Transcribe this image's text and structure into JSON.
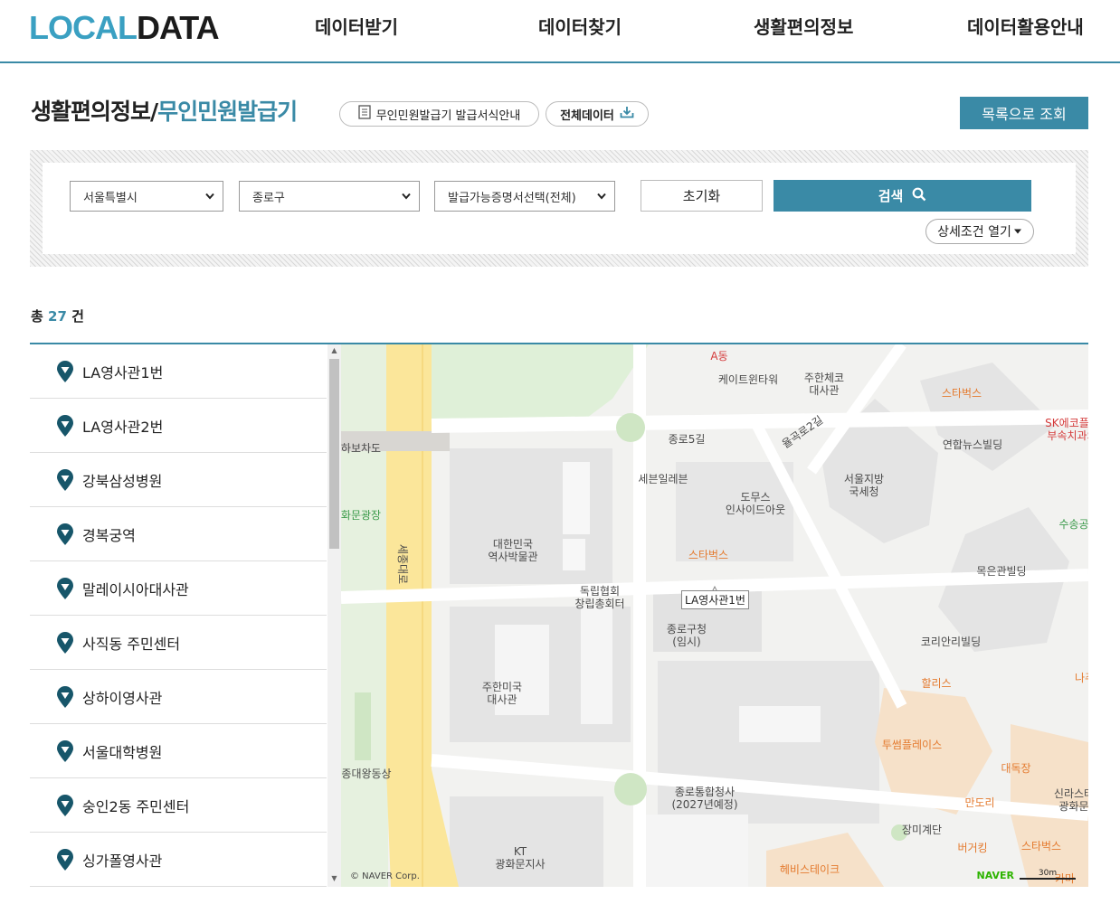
{
  "header": {
    "logo_local": "LOCAL",
    "logo_data": "DATA",
    "nav": [
      "데이터받기",
      "데이터찾기",
      "생활편의정보",
      "데이터활용안내"
    ]
  },
  "title": {
    "main": "생활편의정보/",
    "sub": "무인민원발급기",
    "guide_button": "무인민원발급기 발급서식안내",
    "full_data_button": "전체데이터",
    "list_button": "목록으로 조회"
  },
  "search": {
    "region": "서울특별시",
    "district": "종로구",
    "certificate": "발급가능증명서선택(전체)",
    "reset_label": "초기화",
    "search_label": "검색",
    "detail_label": "상세조건 열기"
  },
  "count": {
    "prefix": "총",
    "value": "27",
    "suffix": "건"
  },
  "results": [
    "LA영사관1번",
    "LA영사관2번",
    "강북삼성병원",
    "경복궁역",
    "말레이시아대사관",
    "사직동 주민센터",
    "상하이영사관",
    "서울대학병원",
    "숭인2동 주민센터",
    "싱가폴영사관"
  ],
  "map": {
    "marker_label": "LA영사관1번",
    "copyright": "© NAVER Corp.",
    "brand": "NAVER",
    "scale": "30m",
    "pois": [
      {
        "name": "A동",
        "style": "red"
      },
      {
        "name": "케이트윈타워",
        "style": "gray"
      },
      {
        "name": "주한체코\n대사관",
        "style": "gray"
      },
      {
        "name": "스타벅스",
        "style": "orange"
      },
      {
        "name": "SK에코플랜\n부속치과의",
        "style": "red"
      },
      {
        "name": "연합뉴스빌딩",
        "style": "gray"
      },
      {
        "name": "종로5길",
        "style": "gray"
      },
      {
        "name": "율곡로2길",
        "style": "gray"
      },
      {
        "name": "하보차도",
        "style": "gray"
      },
      {
        "name": "세븐일레븐",
        "style": "gray"
      },
      {
        "name": "도무스\n인사이드아웃",
        "style": "gray"
      },
      {
        "name": "서울지방\n국세청",
        "style": "gray"
      },
      {
        "name": "수송공",
        "style": "green"
      },
      {
        "name": "화문광장",
        "style": "green"
      },
      {
        "name": "대한민국\n역사박물관",
        "style": "gray"
      },
      {
        "name": "스타벅스",
        "style": "orange"
      },
      {
        "name": "목은관빌딩",
        "style": "gray"
      },
      {
        "name": "세종대로",
        "style": "gray"
      },
      {
        "name": "독립협회\n창립총회터",
        "style": "gray"
      },
      {
        "name": "종로구청\n(임시)",
        "style": "gray"
      },
      {
        "name": "코리안리빌딩",
        "style": "gray"
      },
      {
        "name": "할리스",
        "style": "orange"
      },
      {
        "name": "나주",
        "style": "orange"
      },
      {
        "name": "주한미국\n대사관",
        "style": "gray"
      },
      {
        "name": "투썸플레이스",
        "style": "orange"
      },
      {
        "name": "대독장",
        "style": "orange"
      },
      {
        "name": "종대왕동상",
        "style": "gray"
      },
      {
        "name": "종로통합청사\n(2027년예정)",
        "style": "gray"
      },
      {
        "name": "만도리",
        "style": "orange"
      },
      {
        "name": "신라스테\n광화문",
        "style": "gray"
      },
      {
        "name": "장미계단",
        "style": "gray"
      },
      {
        "name": "KT\n광화문지사",
        "style": "gray"
      },
      {
        "name": "버거킹",
        "style": "orange"
      },
      {
        "name": "스타벅스",
        "style": "orange"
      },
      {
        "name": "헤비스테이크",
        "style": "orange"
      },
      {
        "name": "카마",
        "style": "orange"
      }
    ]
  },
  "colors": {
    "accent": "#3a8aa6",
    "logo_blue": "#3aa0c2",
    "pin": "#17566a"
  }
}
